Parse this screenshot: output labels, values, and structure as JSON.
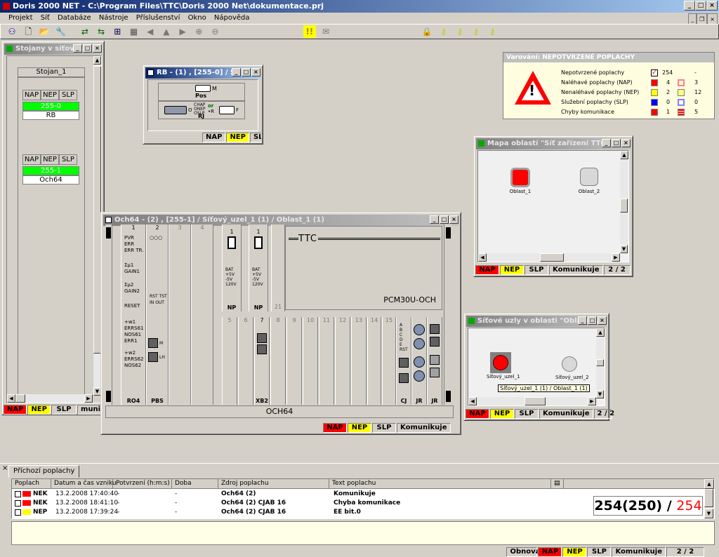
{
  "app": {
    "title": "Doris 2000 NET - C:\\Program Files\\TTC\\Doris 2000 Net\\dokumentace.prj"
  },
  "menu": [
    "Projekt",
    "Síť",
    "Databáze",
    "Nástroje",
    "Příslušenství",
    "Okno",
    "Nápověda"
  ],
  "stojany": {
    "title": "Stojany v síťové...",
    "header": "Stojan_1",
    "units": [
      {
        "nap": "NAP",
        "nep": "NEP",
        "slp": "SLP",
        "address": "255-0",
        "name": "RB"
      },
      {
        "nap": "NAP",
        "nep": "NEP",
        "slp": "SLP",
        "address": "255-1",
        "name": "Och64"
      }
    ],
    "status": {
      "nap": "NAP",
      "nep": "NEP",
      "slp": "SLP",
      "kom": "munikuj"
    }
  },
  "rb": {
    "title": "RB - (1) , [255-0] / Síť...",
    "pos_label": "Pos",
    "m_label": "M",
    "rj_label": "RJ",
    "o_label": "O",
    "f_label": "F",
    "chap_lines": [
      "CHAP",
      "ONEP",
      "OSLP"
    ],
    "or_label": "or",
    "r_label": "•R",
    "status": {
      "nap": "NAP",
      "nep": "NEP",
      "slp": "SLP"
    }
  },
  "warning": {
    "title": "Varování: NEPOTVRZENÉ POPLACHY",
    "rows": [
      {
        "label": "Nepotvrzené poplachy",
        "value": "254",
        "value2": "-",
        "color": "#0000ff"
      },
      {
        "label": "Naléhavé poplachy (NAP)",
        "value": "4",
        "value2": "3",
        "color": "#ff0000"
      },
      {
        "label": "Nenaléhavé poplachy (NEP)",
        "value": "2",
        "value2": "12",
        "color": "#ffff00"
      },
      {
        "label": "Služební poplachy (SLP)",
        "value": "0",
        "value2": "0",
        "color": "#0000ff"
      },
      {
        "label": "Chyby komunikace",
        "value": "1",
        "value2": "5",
        "color": "#ff0000"
      }
    ]
  },
  "mapa": {
    "title": "Mapa oblastí \"Síť zařízení TTC\"",
    "areas": [
      "Oblast_1",
      "Oblast_2"
    ],
    "status": {
      "nap": "NAP",
      "nep": "NEP",
      "slp": "SLP",
      "kom": "Komunikuje",
      "page": "2 / 2"
    }
  },
  "uzly": {
    "title": "Síťové uzly v oblasti \"Oblast_...",
    "nodes": [
      "Síťový_uzel_1",
      "Síťový_uzel_2"
    ],
    "tooltip": "Síťový_uzel_1 (1) / Oblast_1 (1)",
    "status": {
      "nap": "NAP",
      "nep": "NEP",
      "slp": "SLP",
      "kom": "Komunikuje",
      "page": "2 / 2"
    }
  },
  "och": {
    "title": "Och64 - (2) , [255-1] / Síťový_uzel_1 (1) / Oblast_1 (1)",
    "slot_numbers": [
      "1",
      "2",
      "3",
      "4",
      "5",
      "6",
      "7",
      "8",
      "9",
      "10",
      "11",
      "12",
      "13",
      "14",
      "15",
      "21"
    ],
    "card_labels": {
      "ro4": "RO4",
      "pbs": "PBS",
      "np1": "NP",
      "np2": "NP",
      "xb2": "XB2",
      "cj": "CJ",
      "jr1": "JR",
      "jr2": "JR",
      "lh": "LH"
    },
    "ro4_leds": [
      "PVR",
      "ERR",
      "ERR TR."
    ],
    "ro4_g1": [
      "Σμ1",
      "GAIN1"
    ],
    "ro4_g2": [
      "Σμ2",
      "GAIN2"
    ],
    "ro4_reset": "RESET",
    "ro4_w1": [
      "+w1",
      "ERRS61",
      "NOS61",
      "ERR1"
    ],
    "ro4_w2": [
      "+w2",
      "ERRS62",
      "NOS62",
      "ERR2"
    ],
    "pbs_labels": [
      "RST",
      "TST",
      "IN",
      "OUT",
      "M",
      "LH"
    ],
    "np_leds": [
      "BAT",
      "+5V",
      "-5V",
      "120V"
    ],
    "cj_leds": [
      "A",
      "B",
      "C",
      "D",
      "E",
      "RST"
    ],
    "brand": "TTC",
    "model": "PCM30U-OCH",
    "footer": "OCH64",
    "status": {
      "nap": "NAP",
      "nep": "NEP",
      "slp": "SLP",
      "kom": "Komunikuje"
    }
  },
  "alarms": {
    "tab": "Příchozí poplachy",
    "columns": [
      "Poplach",
      "Datum a čas vzniku",
      "Potvrzení (h:m:s)",
      "Doba",
      "Zdroj poplachu",
      "Text poplachu"
    ],
    "rows": [
      {
        "type": "NEK",
        "date": "13.2.2008 17:40:40",
        "ack": "-",
        "dur": "-",
        "source": "Och64 (2)",
        "text": "Komunikuje",
        "color": "#ff0000"
      },
      {
        "type": "NEK",
        "date": "13.2.2008 18:41:10",
        "ack": "-",
        "dur": "-",
        "source": "Och64 (2) CJAB 16",
        "text": "Chyba komunikace",
        "color": "#ff0000"
      },
      {
        "type": "NEP",
        "date": "13.2.2008 17:39:24",
        "ack": "-",
        "dur": "-",
        "source": "Och64 (2) CJAB 16",
        "text": "EE bit.0",
        "color": "#ffff00"
      }
    ],
    "counter_main": "254(250) /",
    "counter_red": "254"
  },
  "statusbar": {
    "obnova": "Obnova",
    "nap": "NAP",
    "nep": "NEP",
    "slp": "SLP",
    "kom": "Komunikuje",
    "page": "2 / 2"
  }
}
